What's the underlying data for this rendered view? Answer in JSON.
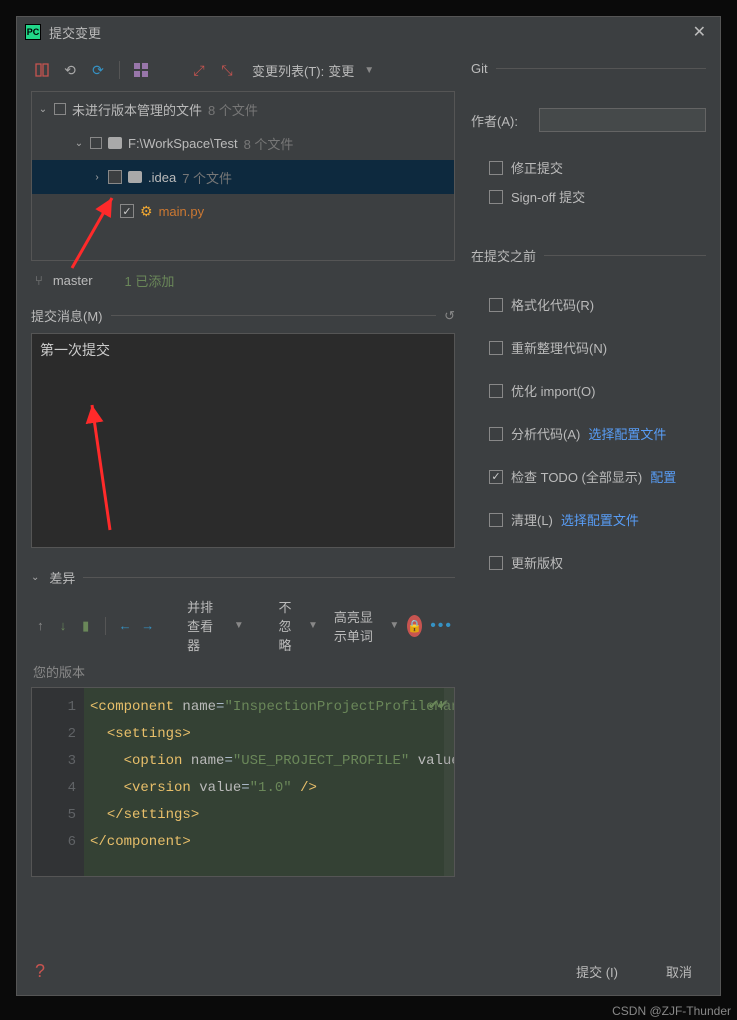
{
  "title": "提交变更",
  "toolbar": {
    "changelist_label": "变更列表(T):",
    "changelist_value": "变更"
  },
  "tree": {
    "root_label": "未进行版本管理的文件",
    "root_count": "8 个文件",
    "folder_label": "F:\\WorkSpace\\Test",
    "folder_count": "8 个文件",
    "idea_label": ".idea",
    "idea_count": "7 个文件",
    "main_label": "main.py"
  },
  "branch": {
    "name": "master",
    "added": "1 已添加"
  },
  "commit_msg": {
    "label": "提交消息(M)",
    "text": "第一次提交"
  },
  "diff": {
    "label": "差异",
    "viewer": "并排查看器",
    "ignore": "不忽略",
    "highlight": "高亮显示单词",
    "your_version": "您的版本"
  },
  "code": {
    "lines": [
      "<component name=\"InspectionProjectProfileManager\">",
      "  <settings>",
      "    <option name=\"USE_PROJECT_PROFILE\" value=\"false\" />",
      "    <version value=\"1.0\" />",
      "  </settings>",
      "</component>"
    ]
  },
  "git": {
    "section": "Git",
    "author_label": "作者(A):",
    "amend": "修正提交",
    "signoff": "Sign-off 提交"
  },
  "before_commit": {
    "section": "在提交之前",
    "format_code": "格式化代码(R)",
    "rearrange": "重新整理代码(N)",
    "optimize_imports": "优化 import(O)",
    "analyze": "分析代码(A)",
    "analyze_link": "选择配置文件",
    "todo": "检查 TODO (全部显示)",
    "todo_link": "配置",
    "cleanup": "清理(L)",
    "cleanup_link": "选择配置文件",
    "update_copy": "更新版权"
  },
  "footer": {
    "commit": "提交 (I)",
    "cancel": "取消"
  },
  "watermark": "CSDN @ZJF-Thunder"
}
